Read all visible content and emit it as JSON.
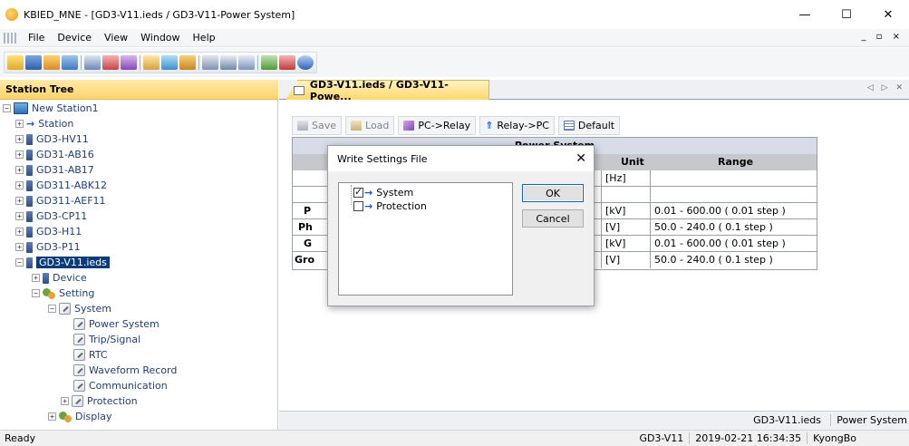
{
  "window": {
    "title": "KBIED_MNE - [GD3-V11.ieds / GD3-V11-Power System]",
    "controls": [
      "—",
      "☐",
      "✕"
    ]
  },
  "menu": {
    "items": [
      "File",
      "Device",
      "View",
      "Window",
      "Help"
    ],
    "mdi_controls": "_ ▫ ×"
  },
  "tree": {
    "header": "Station Tree",
    "root": "New Station1",
    "station": "Station",
    "devices": [
      "GD3-HV11",
      "GD31-AB16",
      "GD31-AB17",
      "GD311-ABK12",
      "GD311-AEF11",
      "GD3-CP11",
      "GD3-H11",
      "GD3-P11"
    ],
    "selected": "GD3-V11.ieds",
    "children": {
      "device": "Device",
      "setting": "Setting",
      "system": "System",
      "system_items": [
        "Power System",
        "Trip/Signal",
        "RTC",
        "Waveform Record",
        "Communication"
      ],
      "protection": "Protection",
      "display": "Display"
    },
    "plus": "+",
    "minus": "−"
  },
  "doc": {
    "tab_label": "GD3-V11.ieds / GD3-V11-Powe...",
    "tab_nav": "◁ ▷ ✕",
    "buttons": {
      "save": "Save",
      "load": "Load",
      "pc_relay": "PC->Relay",
      "relay_pc": "Relay->PC",
      "default": "Default"
    },
    "table": {
      "title": "Power System",
      "headers": {
        "unit": "Unit",
        "range": "Range"
      },
      "rows": [
        {
          "name": "",
          "unit": "[Hz]",
          "range": ""
        },
        {
          "name": "",
          "unit": "",
          "range": ""
        },
        {
          "name": "P",
          "unit": "[kV]",
          "range": "0.01 - 600.00 ( 0.01 step )"
        },
        {
          "name": "Ph",
          "unit": "[V]",
          "range": "50.0 - 240.0 ( 0.1 step )"
        },
        {
          "name": "G",
          "unit": "[kV]",
          "range": "0.01 - 600.00 ( 0.01 step )"
        },
        {
          "name": "Gro",
          "unit": "[V]",
          "range": "50.0 - 240.0 ( 0.1 step )"
        }
      ]
    },
    "status": {
      "file": "GD3-V11.ieds",
      "name": "Power System"
    }
  },
  "dialog": {
    "title": "Write Settings File",
    "close": "✕",
    "items": [
      {
        "label": "System",
        "checked": true
      },
      {
        "label": "Protection",
        "checked": false
      }
    ],
    "ok": "OK",
    "cancel": "Cancel"
  },
  "statusbar": {
    "ready": "Ready",
    "device": "GD3-V11",
    "datetime": "2019-02-21 16:34:35",
    "user": "KyongBo"
  },
  "colors": {
    "tree_header": "#ffd46b",
    "selected_bg": "#0a3c7a",
    "arrow": "#1a4fd6"
  }
}
